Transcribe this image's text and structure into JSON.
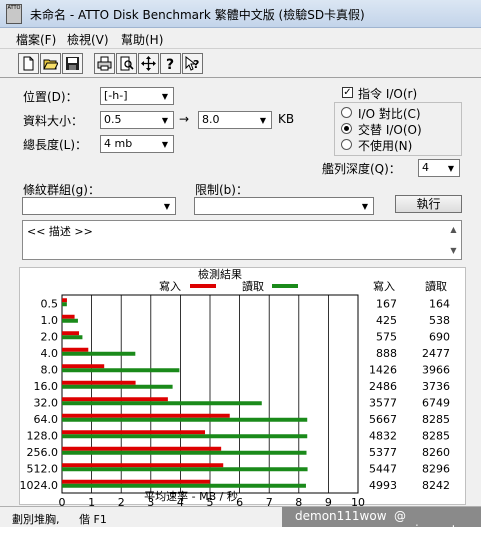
{
  "window": {
    "title": "未命名 - ATTO Disk Benchmark  繁體中文版 (檢驗SD卡真假)",
    "icon_text": "ATTO"
  },
  "menu": {
    "items": [
      "檔案(F)",
      "檢視(V)",
      "幫助(H)"
    ]
  },
  "toolbar": {
    "icons": [
      "new-file-icon",
      "open-folder-icon",
      "save-icon",
      "print-icon",
      "print-preview-icon",
      "move-icon",
      "help-icon",
      "context-help-icon"
    ]
  },
  "form": {
    "drive_label": "位置(D)：",
    "drive_value": "[-h-]",
    "transfer_label": "資料大小：",
    "transfer_from": "0.5",
    "arrow": "→",
    "transfer_to": "8.0",
    "transfer_unit": "KB",
    "length_label": "總長度(L)：",
    "length_value": "4 mb",
    "direct_io_label": "指令 I/O(r)",
    "direct_io_checked": true,
    "io_compare_label": "I/O 對比(C)",
    "overlapped_io_label": "交替 I/O(O)",
    "neither_label": "不使用(N)",
    "selected_io": "overlapped",
    "queue_label": "艦列深度(Q)：",
    "queue_value": "4",
    "stripe_group_label": "條紋群組(g)：",
    "stripe_group_value": "",
    "restriction_label": "限制(b)：",
    "restriction_value": "",
    "start_button": "執行",
    "description_text": "<< 描述 >>"
  },
  "results": {
    "title": "檢測結果",
    "legend_write": "寫入",
    "legend_read": "讀取",
    "col_write": "寫入",
    "col_read": "讀取",
    "write_color": "#dd0000",
    "read_color": "#1a8a1a",
    "axis_title": "平均速率 - MB / 秒"
  },
  "chart_data": {
    "type": "bar",
    "orientation": "horizontal",
    "categories": [
      "0.5",
      "1.0",
      "2.0",
      "4.0",
      "8.0",
      "16.0",
      "32.0",
      "64.0",
      "128.0",
      "256.0",
      "512.0",
      "1024.0"
    ],
    "series": [
      {
        "name": "寫入",
        "values": [
          167,
          425,
          575,
          888,
          1426,
          2486,
          3577,
          5667,
          4832,
          5377,
          5447,
          4993
        ]
      },
      {
        "name": "讀取",
        "values": [
          164,
          538,
          690,
          2477,
          3966,
          3736,
          6749,
          8285,
          8285,
          8260,
          8296,
          8242
        ]
      }
    ],
    "x_ticks": [
      "0",
      "1",
      "2",
      "3",
      "4",
      "5",
      "6",
      "7",
      "8",
      "9",
      "10"
    ],
    "xlabel": "平均速率 - MB / 秒",
    "xlim": [
      0,
      10
    ],
    "grid": true,
    "legend": "top"
  },
  "status": {
    "left_text": "劃別堆胸,",
    "right_text": "偕 F1"
  },
  "watermark": {
    "left": "demon111wow",
    "right": "@ sogi.com.tw"
  }
}
